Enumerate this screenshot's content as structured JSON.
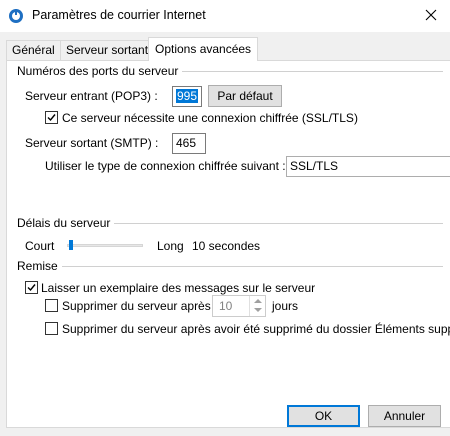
{
  "window": {
    "title": "Paramètres de courrier Internet",
    "close_icon": "close-icon"
  },
  "tabs": [
    {
      "label": "Général",
      "active": false
    },
    {
      "label": "Serveur sortant",
      "active": false
    },
    {
      "label": "Options avancées",
      "active": true
    }
  ],
  "ports": {
    "group_title": "Numéros des ports du serveur",
    "incoming_label": "Serveur entrant (POP3) :",
    "incoming_value": "995",
    "default_button": "Par défaut",
    "ssl_checkbox_label": "Ce serveur nécessite une connexion chiffrée (SSL/TLS)",
    "ssl_checked": true,
    "outgoing_label": "Serveur sortant (SMTP) :",
    "outgoing_value": "465",
    "encryption_label": "Utiliser le type de connexion chiffrée suivant :",
    "encryption_value": "SSL/TLS"
  },
  "timeouts": {
    "group_title": "Délais du serveur",
    "short_label": "Court",
    "long_label": "Long",
    "value_text": "10 secondes",
    "slider_fraction": 0.0
  },
  "delivery": {
    "group_title": "Remise",
    "leave_copy_label": "Laisser un exemplaire des messages sur le serveur",
    "leave_copy_checked": true,
    "remove_after_label": "Supprimer du serveur après",
    "remove_after_checked": false,
    "remove_after_days": "10",
    "days_label": "jours",
    "remove_deleted_label": "Supprimer du serveur après avoir été supprimé du dossier Éléments supprimés",
    "remove_deleted_checked": false
  },
  "buttons": {
    "ok": "OK",
    "cancel": "Annuler"
  },
  "colors": {
    "accent": "#0078d7",
    "panel": "#f0f0f0"
  }
}
